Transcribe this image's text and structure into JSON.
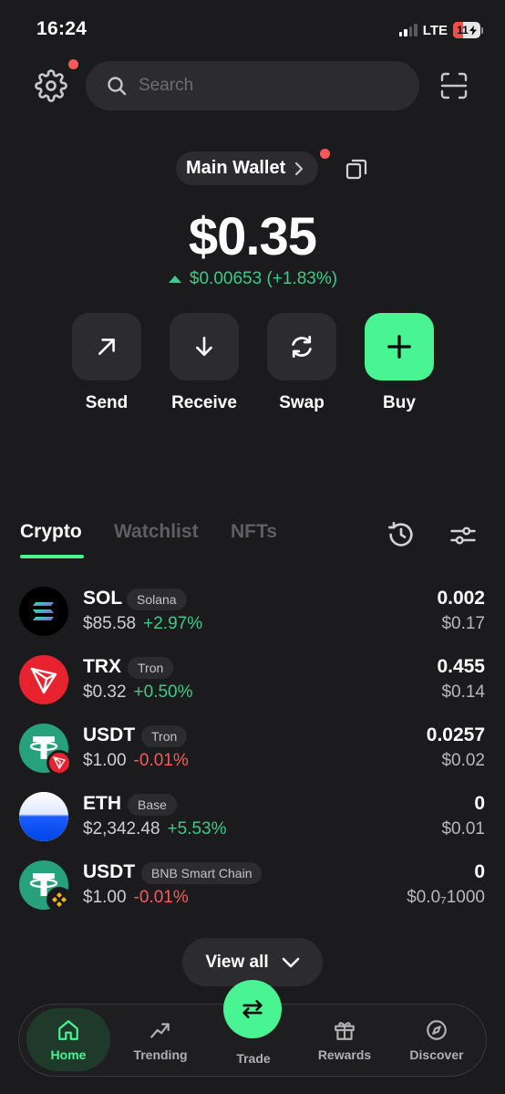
{
  "status_bar": {
    "time": "16:24",
    "network": "LTE",
    "battery": "11"
  },
  "search": {
    "placeholder": "Search"
  },
  "wallet": {
    "name": "Main Wallet",
    "balance": "$0.35",
    "change": "$0.00653 (+1.83%)"
  },
  "actions": [
    {
      "label": "Send",
      "icon": "arrow-up-right-icon"
    },
    {
      "label": "Receive",
      "icon": "arrow-down-icon"
    },
    {
      "label": "Swap",
      "icon": "refresh-icon"
    },
    {
      "label": "Buy",
      "icon": "plus-icon"
    }
  ],
  "tabs": [
    {
      "label": "Crypto",
      "active": true
    },
    {
      "label": "Watchlist",
      "active": false
    },
    {
      "label": "NFTs",
      "active": false
    }
  ],
  "tokens": [
    {
      "symbol": "SOL",
      "chain": "Solana",
      "price": "$85.58",
      "change": "+2.97%",
      "direction": "up",
      "quantity": "0.002",
      "value": "$0.17"
    },
    {
      "symbol": "TRX",
      "chain": "Tron",
      "price": "$0.32",
      "change": "+0.50%",
      "direction": "up",
      "quantity": "0.455",
      "value": "$0.14"
    },
    {
      "symbol": "USDT",
      "chain": "Tron",
      "price": "$1.00",
      "change": "-0.01%",
      "direction": "down",
      "quantity": "0.0257",
      "value": "$0.02"
    },
    {
      "symbol": "ETH",
      "chain": "Base",
      "price": "$2,342.48",
      "change": "+5.53%",
      "direction": "up",
      "quantity": "0",
      "value": "$0.01"
    },
    {
      "symbol": "USDT",
      "chain": "BNB Smart Chain",
      "price": "$1.00",
      "change": "-0.01%",
      "direction": "down",
      "quantity": "0",
      "value": "$0.0₇1000"
    }
  ],
  "view_all": {
    "label": "View all"
  },
  "nav": [
    {
      "label": "Home",
      "icon": "home-icon",
      "active": true
    },
    {
      "label": "Trending",
      "icon": "trending-icon"
    },
    {
      "label": "Trade",
      "icon": "swap-arrows-icon"
    },
    {
      "label": "Rewards",
      "icon": "gift-icon"
    },
    {
      "label": "Discover",
      "icon": "compass-icon"
    }
  ],
  "colors": {
    "background": "#1b1b1d",
    "surface": "#2c2c2e",
    "accent": "#48f592",
    "positive": "#3ec889",
    "negative": "#f25c5c",
    "notification": "#f65a5a"
  }
}
